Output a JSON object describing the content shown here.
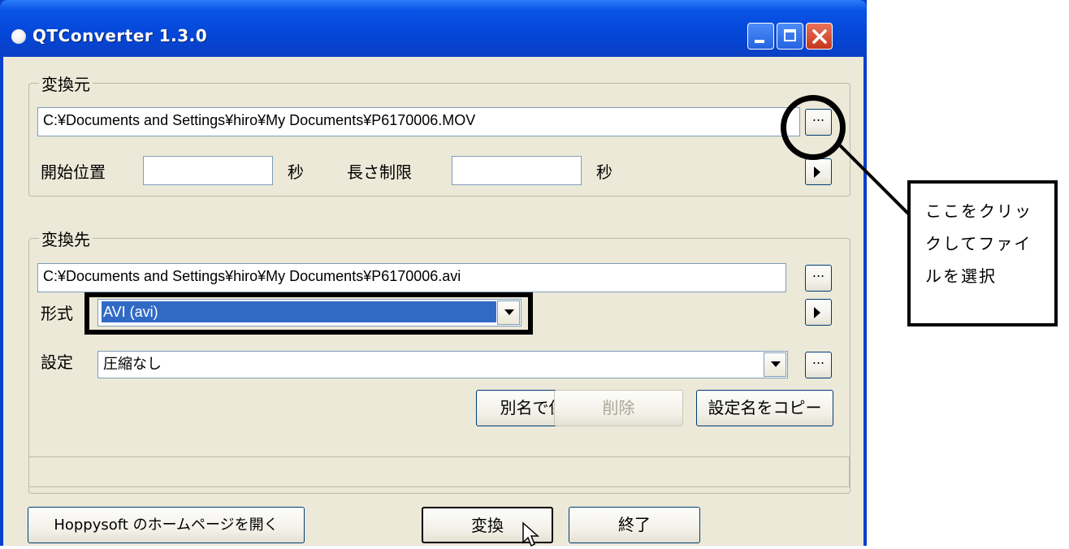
{
  "window": {
    "title": "QTConverter 1.3.0"
  },
  "source": {
    "group_label": "変換元",
    "file_path": "C:¥Documents and Settings¥hiro¥My Documents¥P6170006.MOV",
    "browse_label": "...",
    "start_label": "開始位置",
    "start_value": "",
    "start_unit": "秒",
    "length_label": "長さ制限",
    "length_value": "",
    "length_unit": "秒"
  },
  "dest": {
    "group_label": "変換先",
    "file_path": "C:¥Documents and Settings¥hiro¥My Documents¥P6170006.avi",
    "browse_label": "...",
    "format_label": "形式",
    "format_value": "AVI (avi)",
    "settings_label": "設定",
    "settings_value": "圧縮なし",
    "settings_browse_label": "...",
    "save_as_label": "別名で保存",
    "delete_label": "削除",
    "copy_name_label": "設定名をコピー"
  },
  "footer": {
    "homepage_label": "Hoppysoft のホームページを開く",
    "convert_label": "変換",
    "exit_label": "終了"
  },
  "callout": {
    "line1": "ここをクリッ",
    "line2": "クしてファイ",
    "line3": "ルを選択"
  }
}
